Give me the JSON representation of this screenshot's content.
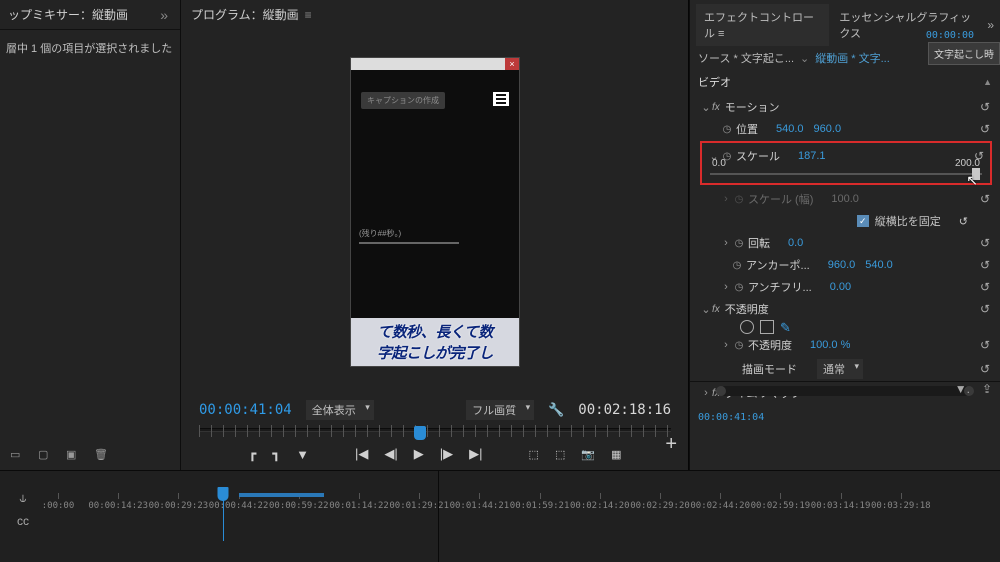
{
  "left": {
    "title": "ップミキサー：縦動画",
    "msg": "層中 1 個の項目が選択されました"
  },
  "center": {
    "title": "プログラム：縦動画",
    "pill": "キャプションの作成",
    "clipinfo": "(残り##秒。)",
    "sub1": "て数秒、長くて数",
    "sub2": "字起こしが完了し",
    "tc_left": "00:00:41:04",
    "tc_right": "00:02:18:16",
    "select_left": "全体表示",
    "select_right": "フル画質"
  },
  "right": {
    "tab1": "エフェクトコントロール",
    "tab2": "エッセンシャルグラフィックス",
    "src": "ソース * 文字起こ...",
    "seq": "縦動画 * 文字...",
    "tc": "00:00:00",
    "tooltip": "文字起こし時",
    "video_hdr": "ビデオ",
    "motion": "モーション",
    "position": "位置",
    "position_x": "540.0",
    "position_y": "960.0",
    "scale": "スケール",
    "scale_v": "187.1",
    "scale_min": "0.0",
    "scale_max": "200.0",
    "scale_w": "スケール (幅)",
    "scale_w_v": "100.0",
    "aspect_lock": "縦横比を固定",
    "rotation": "回転",
    "rotation_v": "0.0",
    "anchor": "アンカーポ...",
    "anchor_x": "960.0",
    "anchor_y": "540.0",
    "antifli": "アンチフリ...",
    "antifli_v": "0.00",
    "opacity_hdr": "不透明度",
    "opacity": "不透明度",
    "opacity_v": "100.0 %",
    "blend": "描画モード",
    "blend_v": "通常",
    "timere": "タイムリマップ",
    "foot_tc": "00:00:41:04"
  },
  "timeline": {
    "ticks": [
      {
        "pos": 0,
        "label": ":00:00"
      },
      {
        "pos": 86,
        "label": "00:00:14:23"
      },
      {
        "pos": 172,
        "label": "00:00:29:23"
      },
      {
        "pos": 258,
        "label": "00:00:44:22"
      },
      {
        "pos": 344,
        "label": "00:00:59:22"
      },
      {
        "pos": 430,
        "label": "00:01:14:22"
      },
      {
        "pos": 516,
        "label": "00:01:29:21"
      },
      {
        "pos": 602,
        "label": "00:01:44:21"
      },
      {
        "pos": 688,
        "label": "00:01:59:21"
      },
      {
        "pos": 774,
        "label": "00:02:14:20"
      },
      {
        "pos": 860,
        "label": "00:02:29:20"
      },
      {
        "pos": 946,
        "label": "00:02:44:20"
      },
      {
        "pos": 1032,
        "label": "00:02:59:19"
      },
      {
        "pos": 1118,
        "label": "00:03:14:19"
      },
      {
        "pos": 1204,
        "label": "00:03:29:18"
      }
    ],
    "playhead": 236,
    "seg_start": 258,
    "seg_end": 380
  }
}
